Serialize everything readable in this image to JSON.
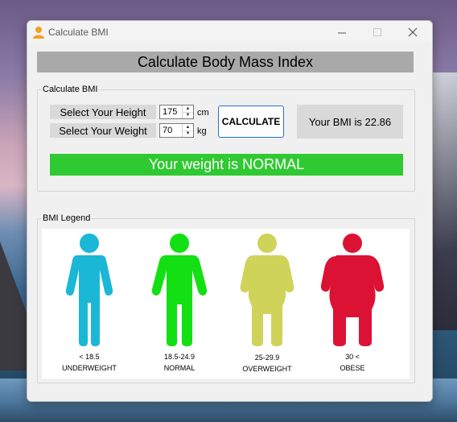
{
  "window": {
    "title": "Calculate BMI"
  },
  "header": {
    "title": "Calculate Body Mass Index"
  },
  "calculate_group": {
    "legend": "Calculate BMI",
    "height_label": "Select Your Height",
    "weight_label": "Select Your Weight",
    "height_value": "175",
    "weight_value": "70",
    "height_unit": "cm",
    "weight_unit": "kg",
    "calculate_button": "CALCULATE",
    "result": "Your BMI is 22.86",
    "status": "Your weight is NORMAL"
  },
  "legend_group": {
    "legend": "BMI Legend",
    "items": [
      {
        "range": "< 18.5",
        "category": "UNDERWEIGHT",
        "color": "#1ab8d6"
      },
      {
        "range": "18.5-24.9",
        "category": "NORMAL",
        "color": "#12e012"
      },
      {
        "range": "25-29.9",
        "category": "OVERWEIGHT",
        "color": "#cfd35a"
      },
      {
        "range": "30 <",
        "category": "OBESE",
        "color": "#dc1235"
      }
    ]
  },
  "colors": {
    "status_bar": "#2fc932",
    "button_border": "#2a6fc9",
    "header_bar": "#a9a9a9"
  }
}
